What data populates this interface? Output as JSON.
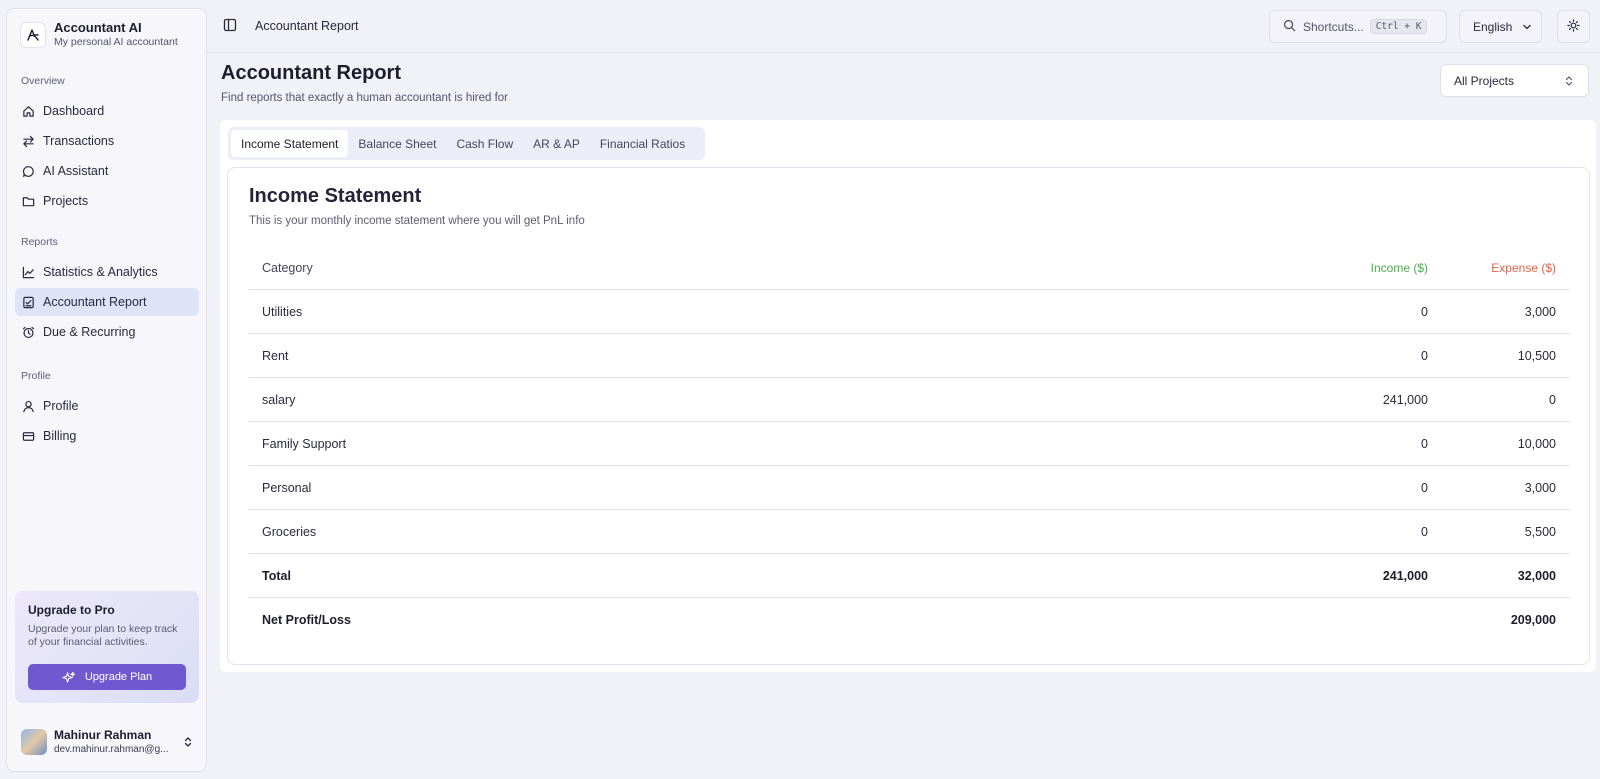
{
  "brand": {
    "name": "Accountant AI",
    "tagline": "My personal AI accountant"
  },
  "sidebar": {
    "sections": [
      {
        "heading": "Overview",
        "items": [
          {
            "label": "Dashboard",
            "icon": "home-icon"
          },
          {
            "label": "Transactions",
            "icon": "transfer-icon"
          },
          {
            "label": "AI Assistant",
            "icon": "chat-icon"
          },
          {
            "label": "Projects",
            "icon": "folder-icon"
          }
        ]
      },
      {
        "heading": "Reports",
        "items": [
          {
            "label": "Statistics & Analytics",
            "icon": "chart-icon"
          },
          {
            "label": "Accountant Report",
            "icon": "report-icon",
            "active": true
          },
          {
            "label": "Due & Recurring",
            "icon": "alarm-icon"
          }
        ]
      },
      {
        "heading": "Profile",
        "items": [
          {
            "label": "Profile",
            "icon": "user-icon"
          },
          {
            "label": "Billing",
            "icon": "card-icon"
          }
        ]
      }
    ],
    "upgrade": {
      "title": "Upgrade to Pro",
      "text": "Upgrade your plan to keep track of your financial activities.",
      "button": "Upgrade Plan"
    },
    "user": {
      "name": "Mahinur Rahman",
      "email": "dev.mahinur.rahman@g..."
    }
  },
  "topbar": {
    "breadcrumb": "Accountant Report",
    "search_label": "Shortcuts...",
    "shortcut": "Ctrl + K",
    "language": "English"
  },
  "header": {
    "title": "Accountant Report",
    "subtitle": "Find reports that exactly a human accountant is hired for",
    "project_select": "All Projects"
  },
  "tabs": [
    "Income Statement",
    "Balance Sheet",
    "Cash Flow",
    "AR & AP",
    "Financial Ratios"
  ],
  "active_tab": "Income Statement",
  "statement": {
    "title": "Income Statement",
    "subtitle": "This is your monthly income statement where you will get PnL info",
    "columns": [
      "Category",
      "Income ($)",
      "Expense ($)"
    ],
    "rows": [
      [
        "Utilities",
        "0",
        "3,000"
      ],
      [
        "Rent",
        "0",
        "10,500"
      ],
      [
        "salary",
        "241,000",
        "0"
      ],
      [
        "Family Support",
        "0",
        "10,000"
      ],
      [
        "Personal",
        "0",
        "3,000"
      ],
      [
        "Groceries",
        "0",
        "5,500"
      ]
    ],
    "total": [
      "Total",
      "241,000",
      "32,000"
    ],
    "net": [
      "Net Profit/Loss",
      "",
      "209,000"
    ]
  },
  "colors": {
    "accent": "#6f59d0",
    "income": "#4caf50",
    "expense": "#e2614a",
    "active_nav": "#dfe3f8"
  }
}
